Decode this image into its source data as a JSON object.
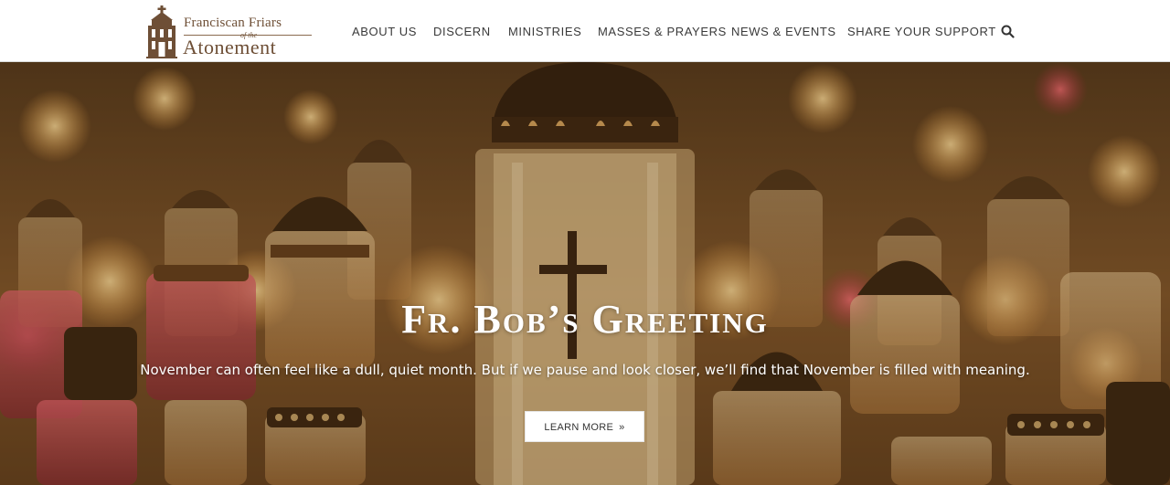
{
  "logo": {
    "line1": "Franciscan Friars",
    "ofthe": "of the",
    "line2": "Atonement"
  },
  "nav": {
    "items": [
      {
        "label": "ABOUT US"
      },
      {
        "label": "DISCERN"
      },
      {
        "label": "MINISTRIES"
      },
      {
        "label": "MASSES & PRAYERS"
      },
      {
        "label": "NEWS & EVENTS"
      },
      {
        "label": "SHARE YOUR SUPPORT"
      }
    ],
    "search_icon": "search-icon"
  },
  "hero": {
    "title": "Fr. Bob’s Greeting",
    "subtitle": "November can often feel like a dull, quiet month. But if we pause and look closer, we’ll find that November is filled with meaning.",
    "cta_label": "LEARN MORE",
    "cta_icon": "double-chevron-right-icon"
  },
  "colors": {
    "brand_brown": "#6e4f36",
    "nav_text": "#3a3a3a",
    "hero_tint": "#8a5a2a"
  }
}
